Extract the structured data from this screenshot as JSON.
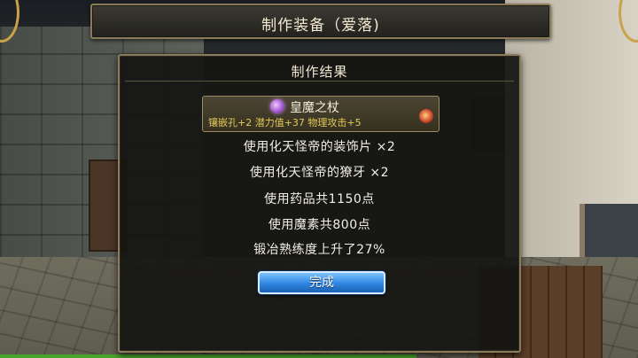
{
  "window": {
    "title": "制作装备（爱落)"
  },
  "result_panel": {
    "title": "制作结果",
    "item": {
      "icon": "staff-orb-icon",
      "name": "皇魔之杖",
      "stats": "镶嵌孔+2  潜力值+37  物理攻击+5",
      "badge_icon": "gem-icon"
    },
    "lines": [
      "使用化天怪帝的装饰片  ×2",
      "使用化天怪帝的獠牙  ×2",
      "使用药品共1150点",
      "使用魔素共800点",
      "锻冶熟练度上升了27%"
    ],
    "done_label": "完成"
  },
  "colors": {
    "accent_button": "#2f86e0",
    "stat_text": "#e3c85a",
    "frame_border": "#8b7b5b"
  }
}
